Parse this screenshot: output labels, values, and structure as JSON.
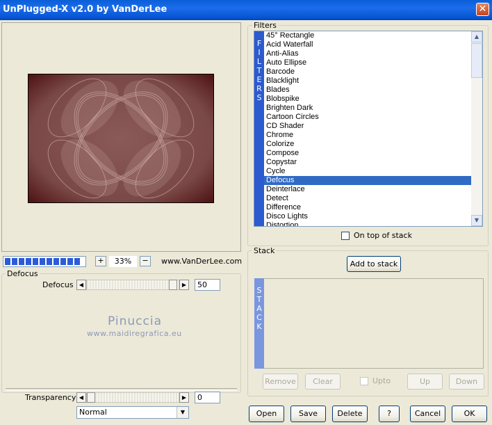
{
  "window": {
    "title": "UnPlugged-X v2.0 by VanDerLee",
    "close_glyph": "✕"
  },
  "zoom": {
    "progress_segments": 11,
    "zoom_in_label": "+",
    "zoom_out_label": "−",
    "value": "33%",
    "website": "www.VanDerLee.com"
  },
  "defocus": {
    "group_label": "Defocus",
    "slider_label": "Defocus",
    "slider_value": "50"
  },
  "watermark": {
    "line1": "Pinuccia",
    "line2": "www.maidiregrafica.eu"
  },
  "transparency": {
    "label": "Transparency",
    "value": "0"
  },
  "blend_mode": {
    "selected": "Normal"
  },
  "filters": {
    "group_label": "Filters",
    "side_label": [
      "F",
      "I",
      "L",
      "T",
      "E",
      "R",
      "S"
    ],
    "items": [
      "45° Rectangle",
      "Acid Waterfall",
      "Anti-Alias",
      "Auto Ellipse",
      "Barcode",
      "Blacklight",
      "Blades",
      "Blobspike",
      "Brighten Dark",
      "Cartoon Circles",
      "CD Shader",
      "Chrome",
      "Colorize",
      "Compose",
      "Copystar",
      "Cycle",
      "Defocus",
      "Deinterlace",
      "Detect",
      "Difference",
      "Disco Lights",
      "Distortion"
    ],
    "selected": "Defocus",
    "on_top_label": "On top of stack"
  },
  "stack": {
    "group_label": "Stack",
    "add_label": "Add to stack",
    "side_label": [
      "S",
      "T",
      "A",
      "C",
      "K"
    ],
    "remove_label": "Remove",
    "clear_label": "Clear",
    "upto_label": "Upto",
    "up_label": "Up",
    "down_label": "Down"
  },
  "buttons": {
    "open": "Open",
    "save": "Save",
    "delete": "Delete",
    "help": "?",
    "cancel": "Cancel",
    "ok": "OK"
  },
  "colors": {
    "accent": "#316AC5",
    "filter_sidebar": "#2C5BCF",
    "preview_bg": "#6A2A2A"
  }
}
